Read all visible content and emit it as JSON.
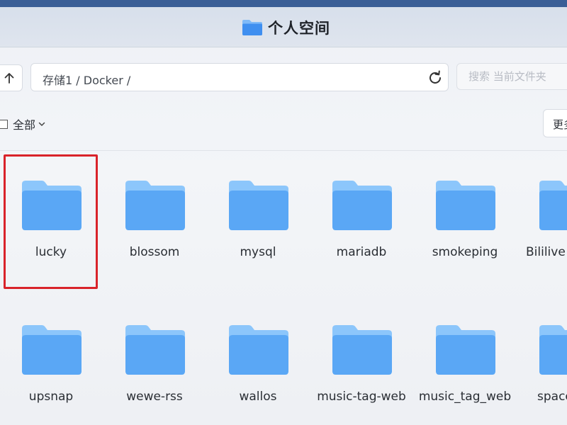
{
  "window": {
    "title": "个人空间",
    "title_icon": "folder-icon"
  },
  "toolbar": {
    "up_icon": "arrow-up-icon",
    "path": "存储1 / Docker /",
    "refresh_icon": "refresh-icon",
    "search_placeholder": "搜索 当前文件夹"
  },
  "selection": {
    "select_all_label": "全部",
    "dropdown_icon": "chevron-down-icon",
    "more_label": "更多"
  },
  "folders_row1": [
    {
      "name": "lucky"
    },
    {
      "name": "blossom"
    },
    {
      "name": "mysql"
    },
    {
      "name": "mariadb"
    },
    {
      "name": "smokeping"
    },
    {
      "name": "Bililive"
    }
  ],
  "folders_row2": [
    {
      "name": "upsnap"
    },
    {
      "name": "wewe-rss"
    },
    {
      "name": "wallos"
    },
    {
      "name": "music-tag-web"
    },
    {
      "name": "music_tag_web"
    },
    {
      "name": "space"
    }
  ],
  "colors": {
    "folder_front": "#5aa7f5",
    "folder_back": "#8cc6fb",
    "highlight": "#d9232a"
  }
}
